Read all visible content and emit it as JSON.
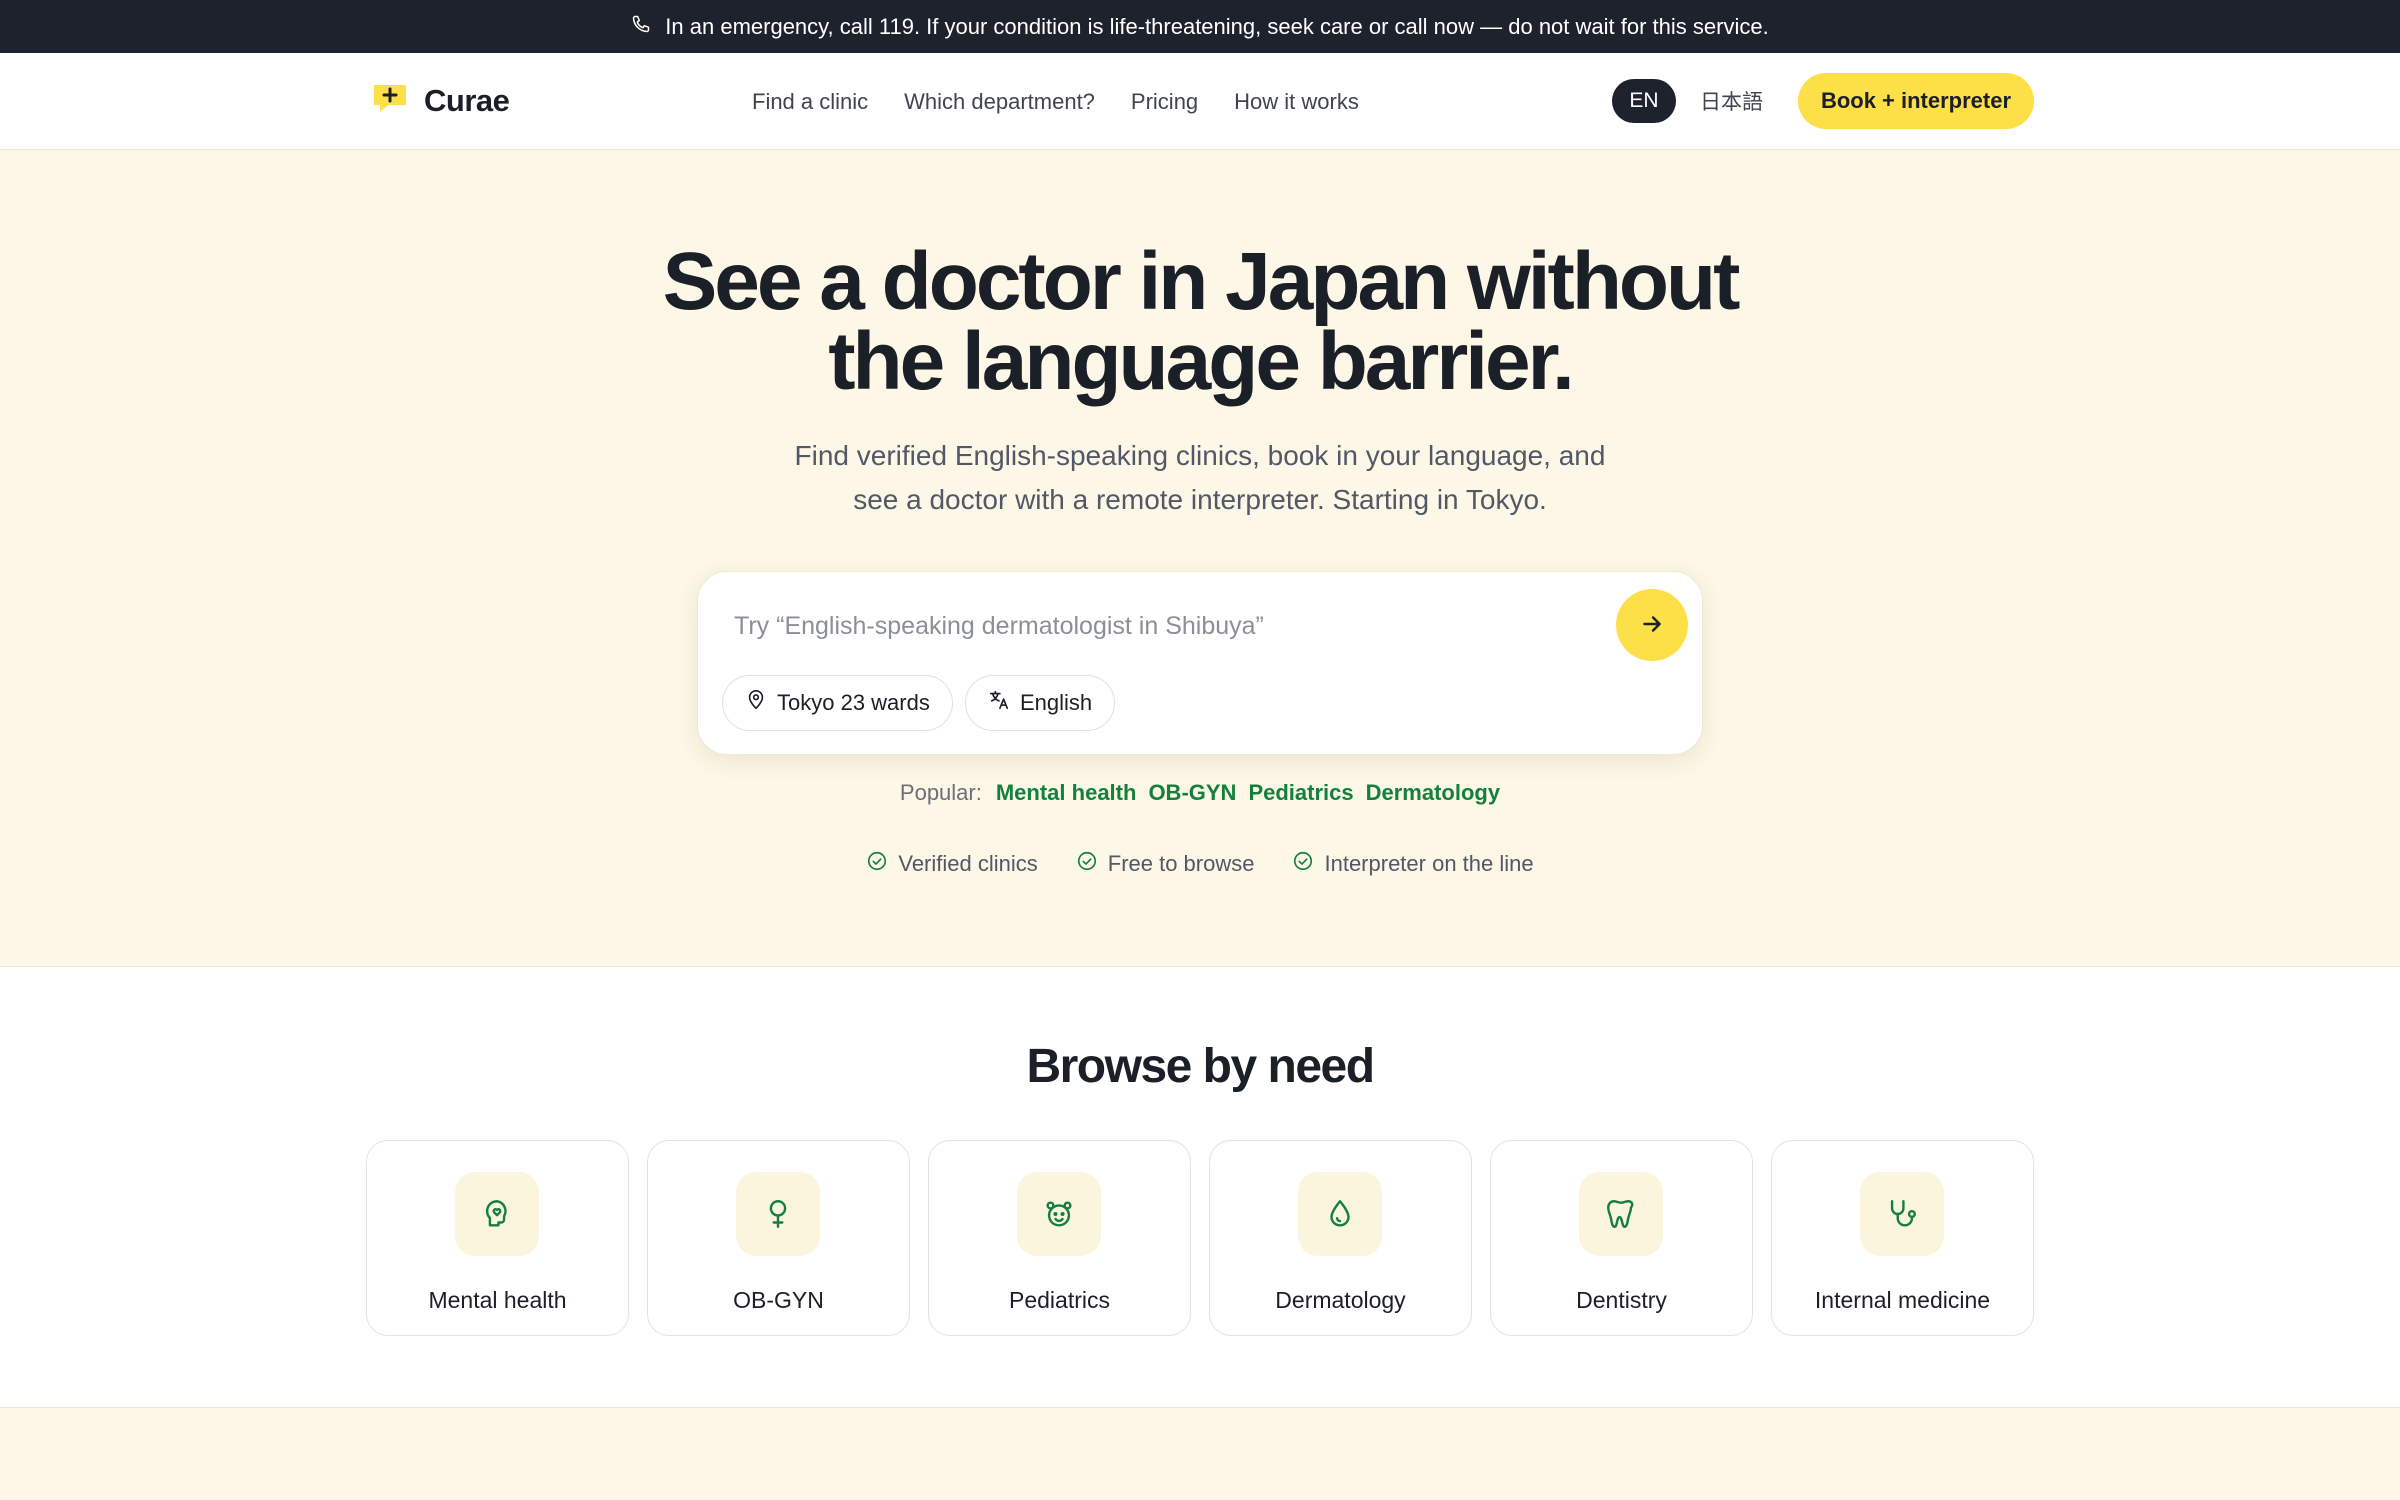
{
  "banner": {
    "text": "In an emergency, call 119. If your condition is life-threatening, seek care or call now — do not wait for this service.",
    "icon": "phone-icon"
  },
  "header": {
    "logo_text": "Curae",
    "nav": [
      "Find a clinic",
      "Which department?",
      "Pricing",
      "How it works"
    ],
    "lang_en": "EN",
    "lang_ja": "日本語",
    "cta_label": "Book + interpreter"
  },
  "hero": {
    "title_line1": "See a doctor in Japan without",
    "title_line2": "the language barrier.",
    "subtitle_line1": "Find verified English-speaking clinics, book in your language, and",
    "subtitle_line2": "see a doctor with a remote interpreter. Starting in Tokyo.",
    "search_placeholder": "Try “English-speaking dermatologist in Shibuya”",
    "search_value": "",
    "chip_location": "Tokyo 23 wards",
    "chip_language": "English",
    "popular_label": "Popular:",
    "popular": [
      "Mental health",
      "OB-GYN",
      "Pediatrics",
      "Dermatology"
    ],
    "trust": [
      "Verified clinics",
      "Free to browse",
      "Interpreter on the line"
    ]
  },
  "browse": {
    "title": "Browse by need",
    "cards": [
      {
        "label": "Mental health",
        "icon": "head-heart-icon"
      },
      {
        "label": "OB-GYN",
        "icon": "female-symbol-icon"
      },
      {
        "label": "Pediatrics",
        "icon": "baby-face-icon"
      },
      {
        "label": "Dermatology",
        "icon": "droplet-icon"
      },
      {
        "label": "Dentistry",
        "icon": "tooth-icon"
      },
      {
        "label": "Internal medicine",
        "icon": "stethoscope-icon"
      }
    ]
  },
  "colors": {
    "accent": "#fde047",
    "dark": "#1d222c",
    "green": "#15803d",
    "hero_bg": "#fcf7e6"
  }
}
